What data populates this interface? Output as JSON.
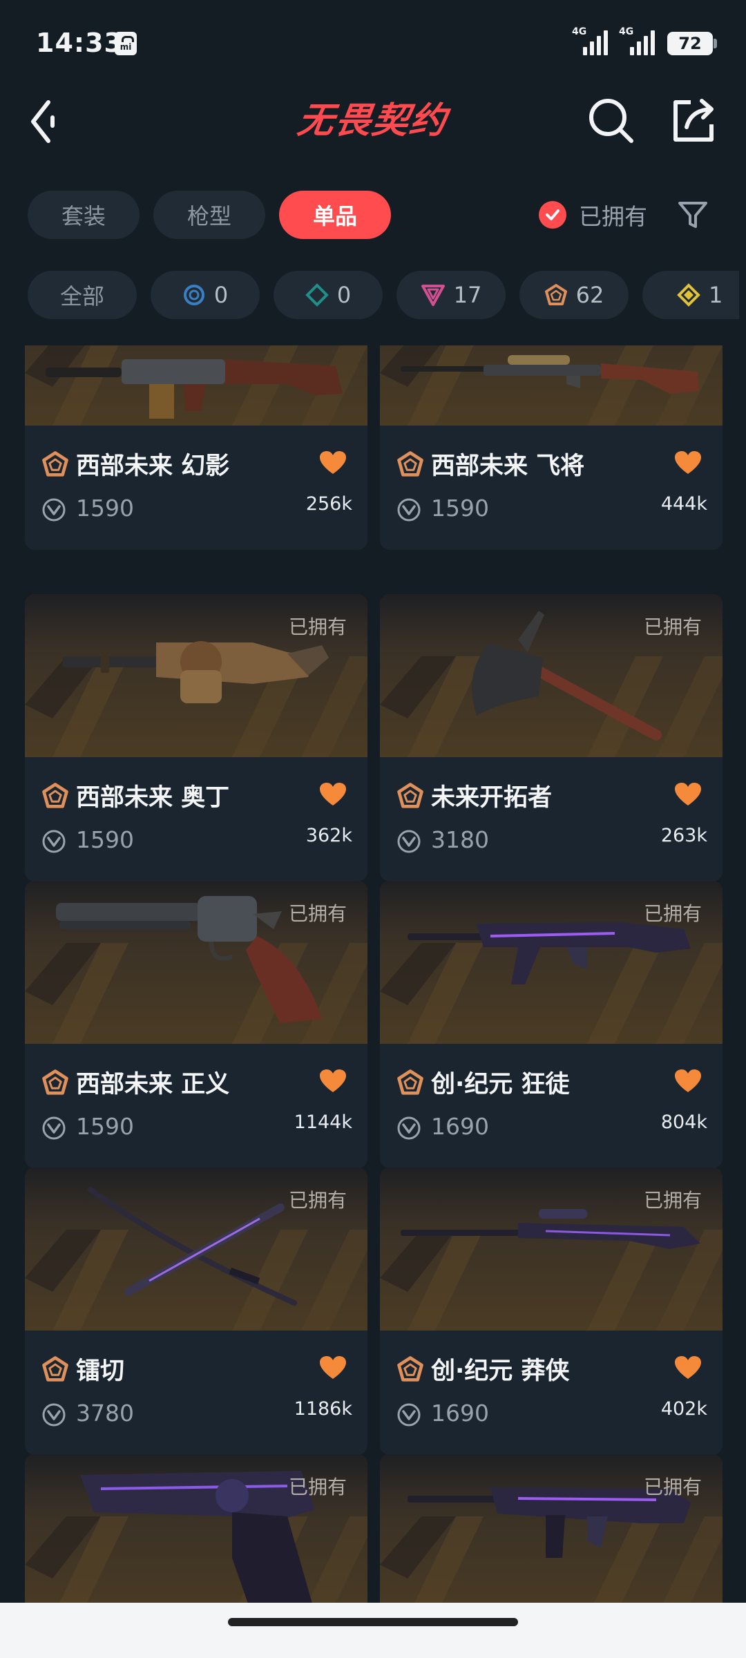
{
  "status_bar": {
    "time": "14:33",
    "carrier_badge": "mi",
    "signal_1": "4G",
    "signal_2": "4G",
    "battery": "72"
  },
  "header": {
    "title": "无畏契约",
    "back_icon": "chevron-left-icon",
    "search_icon": "search-icon",
    "share_icon": "share-icon"
  },
  "tabs": [
    {
      "label": "套装",
      "active": false
    },
    {
      "label": "枪型",
      "active": false
    },
    {
      "label": "单品",
      "active": true
    }
  ],
  "owned_filter": {
    "label": "已拥有",
    "checked": true
  },
  "rarity_filters": [
    {
      "label": "全部"
    },
    {
      "tier": "select",
      "count": "0",
      "color": "#3a7fc4"
    },
    {
      "tier": "deluxe",
      "count": "0",
      "color": "#1f8f88"
    },
    {
      "tier": "premium",
      "count": "17",
      "color": "#d24f91"
    },
    {
      "tier": "ultra",
      "count": "62",
      "color": "#e0905a"
    },
    {
      "tier": "exclusive",
      "count": "1",
      "color": "#e3c23b"
    }
  ],
  "owned_label": "已拥有",
  "skins": [
    {
      "name": "西部未来 幻影",
      "price": "1590",
      "likes": "256k",
      "owned": false
    },
    {
      "name": "西部未来 飞将",
      "price": "1590",
      "likes": "444k",
      "owned": false
    },
    {
      "name": "西部未来 奥丁",
      "price": "1590",
      "likes": "362k",
      "owned": true
    },
    {
      "name": "未来开拓者",
      "price": "3180",
      "likes": "263k",
      "owned": true
    },
    {
      "name": "西部未来 正义",
      "price": "1590",
      "likes": "1144k",
      "owned": true
    },
    {
      "name": "创·纪元 狂徒",
      "price": "1690",
      "likes": "804k",
      "owned": true
    },
    {
      "name": "镭切",
      "price": "3780",
      "likes": "1186k",
      "owned": true
    },
    {
      "name": "创·纪元 莽侠",
      "price": "1690",
      "likes": "402k",
      "owned": true
    },
    {
      "name": "",
      "price": "",
      "likes": "",
      "owned": true
    },
    {
      "name": "",
      "price": "",
      "likes": "",
      "owned": true
    }
  ],
  "colors": {
    "background": "#141c24",
    "card": "#1b252f",
    "accent": "#ff4c4f",
    "heart": "#f58a3a",
    "tier_ultra": "#e0905a"
  }
}
